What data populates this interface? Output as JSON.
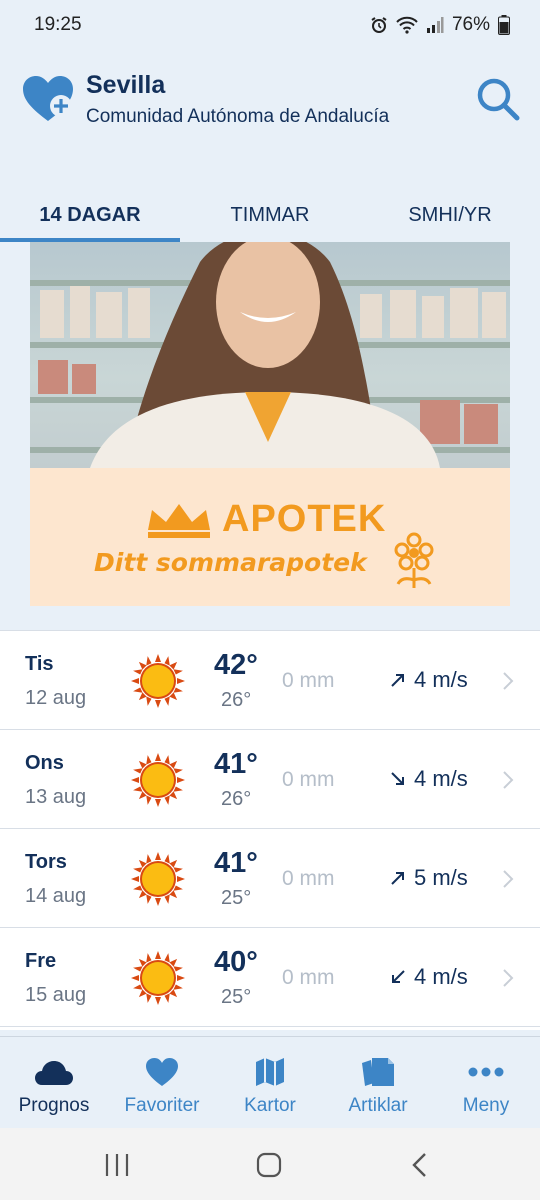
{
  "status_bar": {
    "time": "19:25",
    "battery": "76%"
  },
  "header": {
    "city": "Sevilla",
    "region": "Comunidad Autónoma de Andalucía"
  },
  "tabs": [
    {
      "label": "14 DAGAR",
      "active": true
    },
    {
      "label": "TIMMAR",
      "active": false
    },
    {
      "label": "SMHI/YR",
      "active": false
    }
  ],
  "ad": {
    "brand": "APOTEK",
    "slogan": "Ditt sommarapotek"
  },
  "forecast": [
    {
      "day": "Tis",
      "date": "12 aug",
      "icon": "sun-icon",
      "high": "42°",
      "low": "26°",
      "precip": "0 mm",
      "wind": "4 m/s",
      "wind_dir": "north-east"
    },
    {
      "day": "Ons",
      "date": "13 aug",
      "icon": "sun-icon",
      "high": "41°",
      "low": "26°",
      "precip": "0 mm",
      "wind": "4 m/s",
      "wind_dir": "south-east"
    },
    {
      "day": "Tors",
      "date": "14 aug",
      "icon": "sun-icon",
      "high": "41°",
      "low": "25°",
      "precip": "0 mm",
      "wind": "5 m/s",
      "wind_dir": "north-east"
    },
    {
      "day": "Fre",
      "date": "15 aug",
      "icon": "sun-icon",
      "high": "40°",
      "low": "25°",
      "precip": "0 mm",
      "wind": "4 m/s",
      "wind_dir": "south-west"
    }
  ],
  "bottom_nav": [
    {
      "label": "Prognos",
      "icon": "cloud-icon",
      "active": true
    },
    {
      "label": "Favoriter",
      "icon": "heart-icon",
      "active": false
    },
    {
      "label": "Kartor",
      "icon": "map-icon",
      "active": false
    },
    {
      "label": "Artiklar",
      "icon": "articles-icon",
      "active": false
    },
    {
      "label": "Meny",
      "icon": "more-icon",
      "active": false
    }
  ],
  "colors": {
    "primary": "#13305a",
    "accent": "#3d85c6",
    "background": "#e8f0f8",
    "ad_orange": "#f29a1f"
  }
}
